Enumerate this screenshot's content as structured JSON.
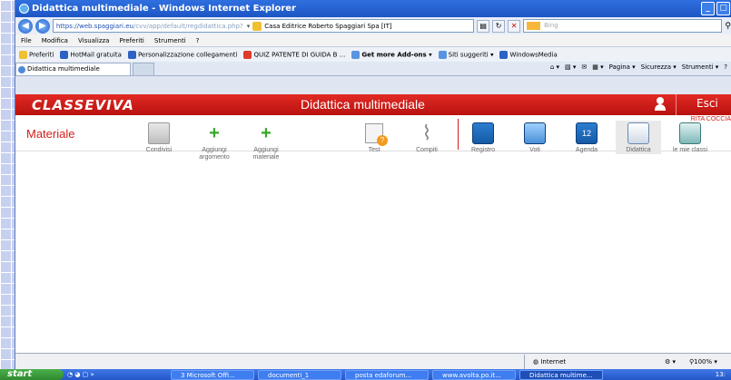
{
  "window": {
    "title": "Didattica multimediale - Windows Internet Explorer"
  },
  "address": {
    "url_secure": "https://",
    "url_host": "web.spaggiari.eu",
    "url_path": "/cvv/app/default/regdidattica.php?",
    "certificate": "Casa Editrice Roberto Spaggiari Spa [IT]",
    "search_placeholder": "Bing"
  },
  "menubar": [
    "File",
    "Modifica",
    "Visualizza",
    "Preferiti",
    "Strumenti",
    "?"
  ],
  "favorites": {
    "label": "Preferiti",
    "items": [
      "HotMail gratuita",
      "Personalizzazione collegamenti",
      "QUIZ PATENTE DI GUIDA B ...",
      "Get more Add-ons",
      "Siti suggeriti",
      "WindowsMedia"
    ]
  },
  "tab": {
    "label": "Didattica multimediale"
  },
  "commandbar": [
    "Pagina",
    "Sicurezza",
    "Strumenti"
  ],
  "app": {
    "logo": "CLASSEVIVA",
    "title": "Didattica multimediale",
    "logout": "Esci",
    "user": "RITA COCCIA",
    "section": "Materiale"
  },
  "tools": [
    {
      "label": "Condivisi",
      "icon": "shared-folder-icon"
    },
    {
      "label": "Aggiungi argomento",
      "icon": "plus-icon"
    },
    {
      "label": "Aggiungi materiale",
      "icon": "plus-icon"
    },
    {
      "label": "Test",
      "icon": "test-icon"
    },
    {
      "label": "Compiti",
      "icon": "paperclip-icon"
    }
  ],
  "nav": [
    {
      "label": "Registro",
      "icon": "register-icon"
    },
    {
      "label": "Voti",
      "icon": "grades-icon"
    },
    {
      "label": "Agenda",
      "icon": "calendar-icon"
    },
    {
      "label": "Didattica",
      "icon": "didactics-icon"
    },
    {
      "label": "le mie classi",
      "icon": "classes-icon"
    }
  ],
  "status": {
    "zone": "Internet",
    "zoom": "100%"
  },
  "taskbar": {
    "start": "start",
    "items": [
      "3 Microsoft Offi...",
      "documenti_1",
      "posta edaforum...",
      "www.avolta.po.it...",
      "Didattica multime..."
    ],
    "clock": "13:"
  },
  "colors": {
    "accent": "#d21e1a",
    "titlebar": "#1d56c4"
  }
}
